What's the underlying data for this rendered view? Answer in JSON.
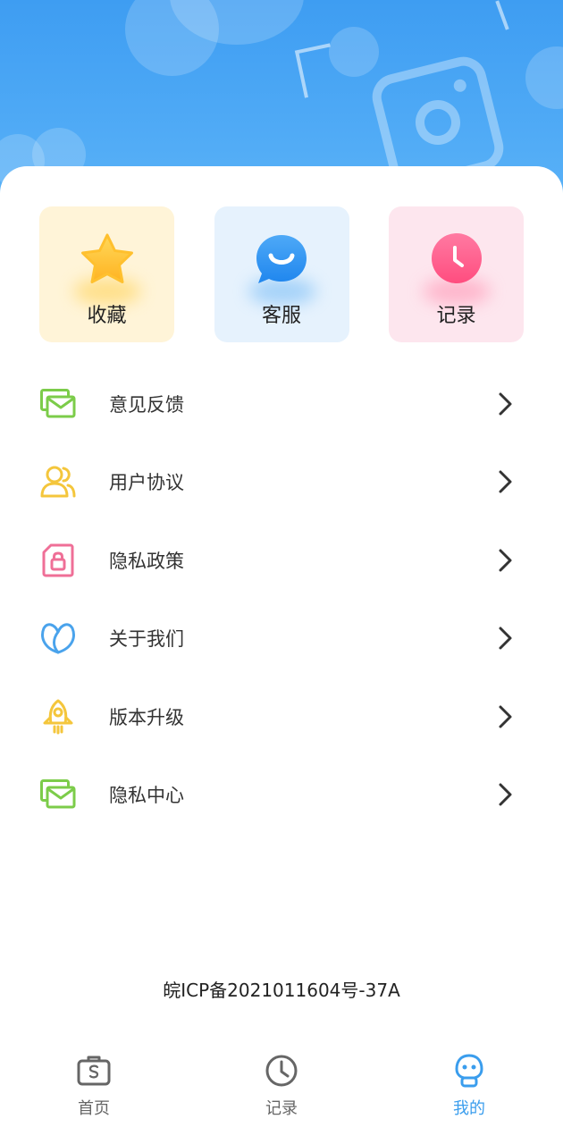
{
  "colors": {
    "accent": "#3a9ded",
    "hero_top": "#3e9df2",
    "favorite": "#ffc93a",
    "service": "#2f94f1",
    "record": "#ff5d8c"
  },
  "quick_cards": [
    {
      "label": "收藏",
      "icon": "star-icon"
    },
    {
      "label": "客服",
      "icon": "chat-bubble-icon"
    },
    {
      "label": "记录",
      "icon": "clock-icon"
    }
  ],
  "menu": [
    {
      "label": "意见反馈",
      "icon": "mail-icon"
    },
    {
      "label": "用户协议",
      "icon": "users-icon"
    },
    {
      "label": "隐私政策",
      "icon": "lock-document-icon"
    },
    {
      "label": "关于我们",
      "icon": "heart-leaf-icon"
    },
    {
      "label": "版本升级",
      "icon": "rocket-icon"
    },
    {
      "label": "隐私中心",
      "icon": "mail-icon"
    }
  ],
  "icp": "皖ICP备2021011604号-37A",
  "tabs": [
    {
      "label": "首页",
      "icon": "briefcase-icon"
    },
    {
      "label": "记录",
      "icon": "clock-icon"
    },
    {
      "label": "我的",
      "icon": "profile-icon"
    }
  ],
  "active_tab": "我的"
}
